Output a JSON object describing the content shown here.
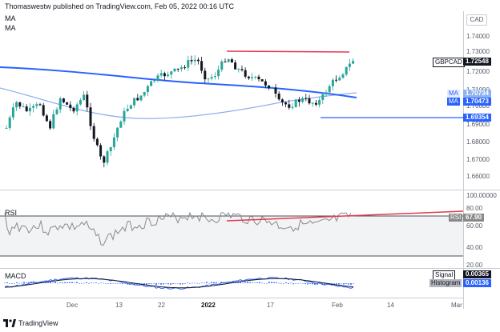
{
  "header": {
    "publish_line": "Thomaswestw published on TradingView.com, Feb 05, 2022 00:16 UTC"
  },
  "indicators": {
    "ma1": "MA",
    "ma2": "MA"
  },
  "currency_button": "CAD",
  "price_ticks": [
    "1.74000",
    "1.73000",
    "1.72000",
    "1.71000",
    "1.70000",
    "1.69000",
    "1.68000",
    "1.67000",
    "1.66000"
  ],
  "price_tags": {
    "symbol": "GBPCAD",
    "last": "1.72548",
    "ma_label_1": "MA",
    "ma_value_1": "1.70734",
    "ma_label_2": "MA",
    "ma_value_2": "1.70473",
    "support": "1.69354"
  },
  "separator_value": "100.00000",
  "rsi": {
    "label": "RSI",
    "tag_label": "RSI",
    "value": "67.90",
    "ticks": [
      "80.00",
      "60.00",
      "40.00",
      "20.00"
    ]
  },
  "macd": {
    "label": "MACD",
    "signal_label": "Signal",
    "signal_value": "0.00365",
    "hist_label": "Histogram",
    "hist_value": "0.00136"
  },
  "dates": [
    "Dec",
    "13",
    "22",
    "2022",
    "17",
    "Feb",
    "14",
    "Mar"
  ],
  "footer": {
    "brand": "TradingView"
  },
  "colors": {
    "up": "#26a69a",
    "down": "#131722",
    "ma_slow": "#2962ff",
    "ma_fast": "#8fb1ee",
    "resistance": "#e53950",
    "support": "#2962ff",
    "rsi_line": "#8a8a8a"
  }
}
